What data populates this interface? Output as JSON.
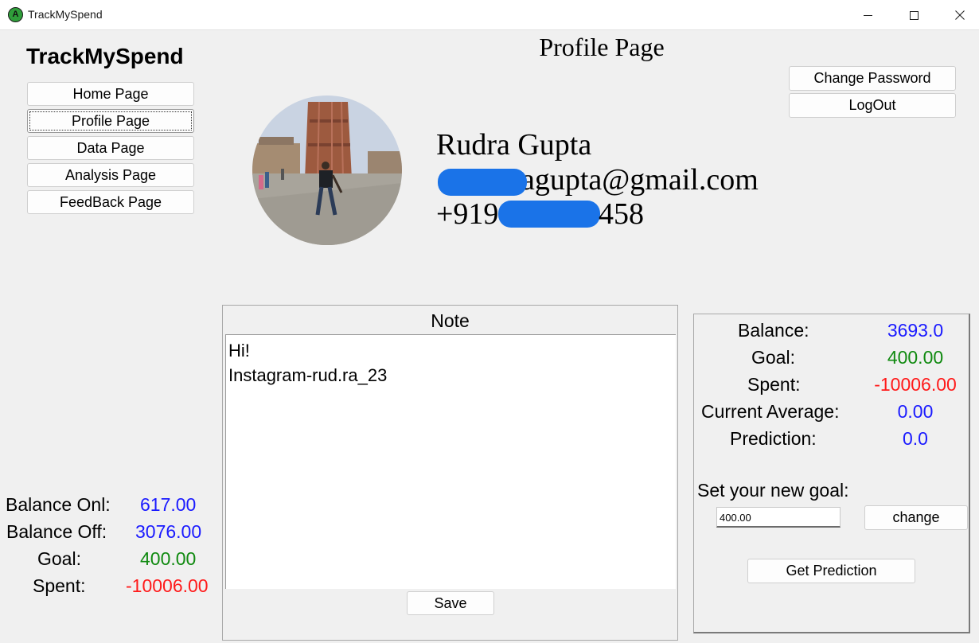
{
  "window": {
    "title": "TrackMySpend"
  },
  "sidebar": {
    "brand": "TrackMySpend",
    "items": [
      {
        "label": "Home Page"
      },
      {
        "label": "Profile Page"
      },
      {
        "label": "Data Page"
      },
      {
        "label": "Analysis Page"
      },
      {
        "label": "FeedBack Page"
      }
    ],
    "active": "Profile Page"
  },
  "page": {
    "title": "Profile Page"
  },
  "header_buttons": {
    "change_password": "Change Password",
    "logout": "LogOut"
  },
  "profile": {
    "name": "Rudra Gupta",
    "email_visible": "agupta@gmail.com",
    "phone_prefix": "+919",
    "phone_suffix": "458",
    "redaction_color": "#1a73e8"
  },
  "left_stats": [
    {
      "label": "Balance Onl:",
      "value": "617.00",
      "color": "#1a1aff"
    },
    {
      "label": "Balance Off:",
      "value": "3076.00",
      "color": "#1a1aff"
    },
    {
      "label": "Goal:",
      "value": "400.00",
      "color": "#108a10"
    },
    {
      "label": "Spent:",
      "value": "-10006.00",
      "color": "#ff1a1a"
    }
  ],
  "note": {
    "title": "Note",
    "text": "Hi!\nInstagram-rud.ra_23",
    "save_label": "Save"
  },
  "summary": {
    "rows": [
      {
        "label": "Balance:",
        "value": "3693.0",
        "color": "#1a1aff"
      },
      {
        "label": "Goal:",
        "value": "400.00",
        "color": "#108a10"
      },
      {
        "label": "Spent:",
        "value": "-10006.00",
        "color": "#ff1a1a"
      },
      {
        "label": "Current Average:",
        "value": "0.00",
        "color": "#1a1aff"
      },
      {
        "label": "Prediction:",
        "value": "0.0",
        "color": "#1a1aff"
      }
    ],
    "goal_prompt": "Set your new goal:",
    "goal_input_value": "400.00",
    "change_label": "change",
    "prediction_label": "Get Prediction"
  }
}
